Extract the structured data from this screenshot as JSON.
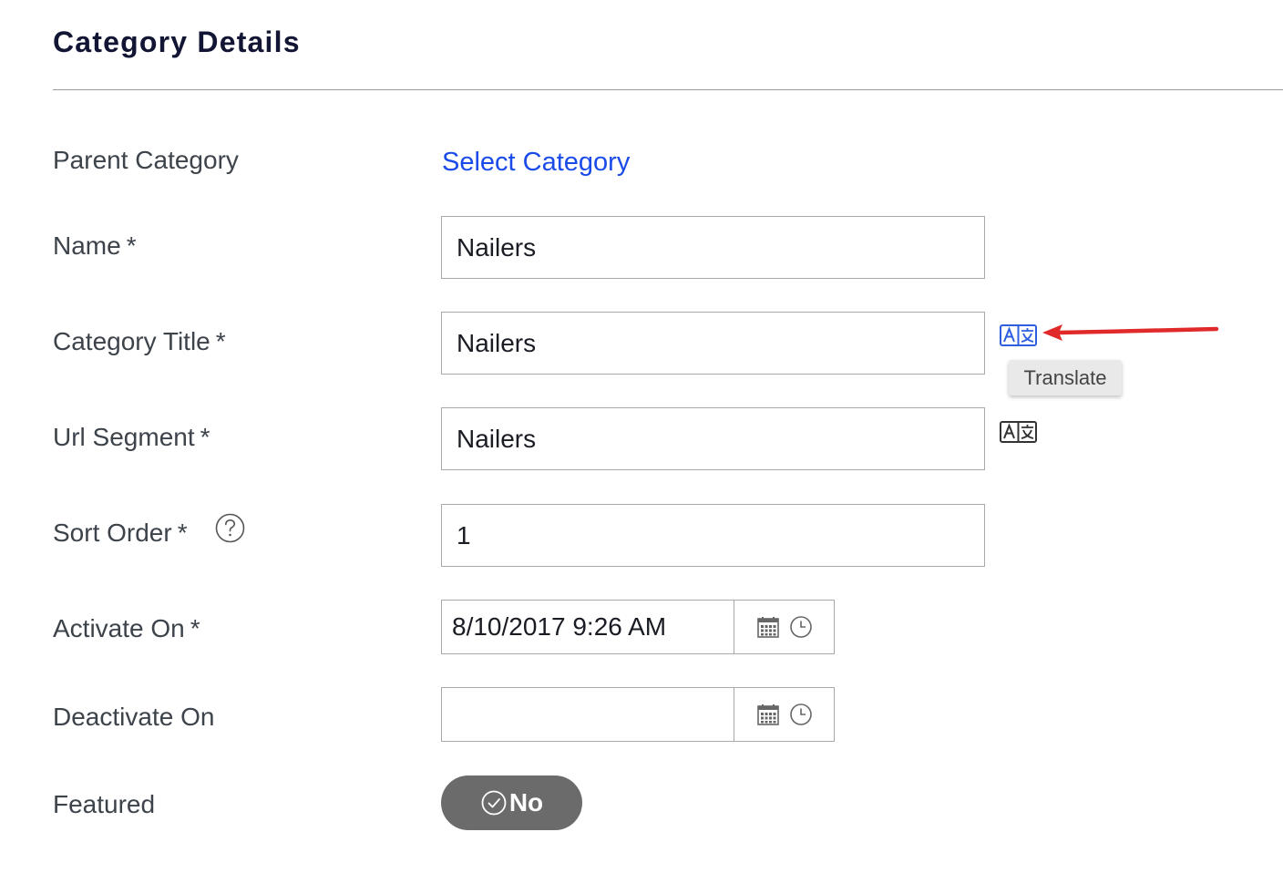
{
  "page": {
    "title": "Category Details"
  },
  "form": {
    "parent_category": {
      "label": "Parent Category",
      "link": "Select Category"
    },
    "name": {
      "label": "Name",
      "required": "*",
      "value": "Nailers"
    },
    "category_title": {
      "label": "Category Title",
      "required": "*",
      "value": "Nailers"
    },
    "url_segment": {
      "label": "Url Segment",
      "required": "*",
      "value": "Nailers"
    },
    "sort_order": {
      "label": "Sort Order",
      "required": "*",
      "value": "1"
    },
    "activate_on": {
      "label": "Activate On",
      "required": "*",
      "value": "8/10/2017 9:26 AM"
    },
    "deactivate_on": {
      "label": "Deactivate On",
      "value": ""
    },
    "featured": {
      "label": "Featured",
      "toggle_label": "No"
    }
  },
  "tooltip": {
    "text": "Translate"
  },
  "icons": {
    "translate": "translate-icon",
    "help": "question-circle-icon",
    "calendar": "calendar-icon",
    "clock": "clock-icon",
    "check": "check-circle-icon",
    "arrow": "red-arrow-annotation"
  },
  "colors": {
    "title": "#121634",
    "link": "#1a4be8",
    "translate_active": "#2f5fe0",
    "translate_default": "#333333",
    "annotation_arrow": "#e02a2a",
    "toggle_bg": "#6b6b6b"
  }
}
